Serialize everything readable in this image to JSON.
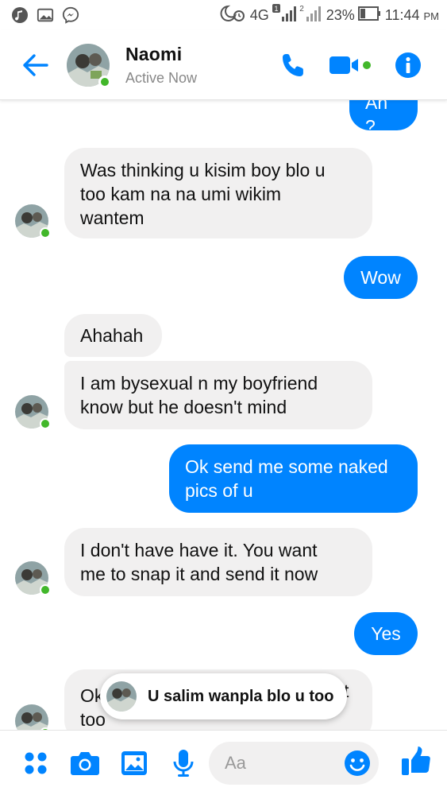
{
  "status_bar": {
    "network": "4G",
    "sim1": "1",
    "sim2": "2",
    "battery": "23%",
    "time": "11:44",
    "ampm": "PM"
  },
  "header": {
    "name": "Naomi",
    "status": "Active Now",
    "accent": "#0084ff"
  },
  "messages": [
    {
      "dir": "out",
      "text": "Ah ?"
    },
    {
      "dir": "in",
      "lines": [
        "Was thinking u kisim boy blo u",
        "too kam na na umi wikim",
        "wantem"
      ]
    },
    {
      "dir": "out",
      "text": "Wow"
    },
    {
      "dir": "in",
      "text": "Ahahah"
    },
    {
      "dir": "in",
      "lines": [
        "I am bysexual n my boyfriend",
        "know but he doesn't mind"
      ]
    },
    {
      "dir": "out",
      "lines": [
        "Ok send me some naked",
        "pics of u"
      ]
    },
    {
      "dir": "in",
      "lines": [
        "I don't have have it. You want",
        "me to snap it and send it now"
      ]
    },
    {
      "dir": "out",
      "text": "Yes"
    },
    {
      "dir": "in",
      "lines": [
        "Ok",
        "too"
      ],
      "trailing": "t"
    }
  ],
  "toast": {
    "text": "U salim wanpla blo u too"
  },
  "composer": {
    "placeholder": "Aa"
  }
}
